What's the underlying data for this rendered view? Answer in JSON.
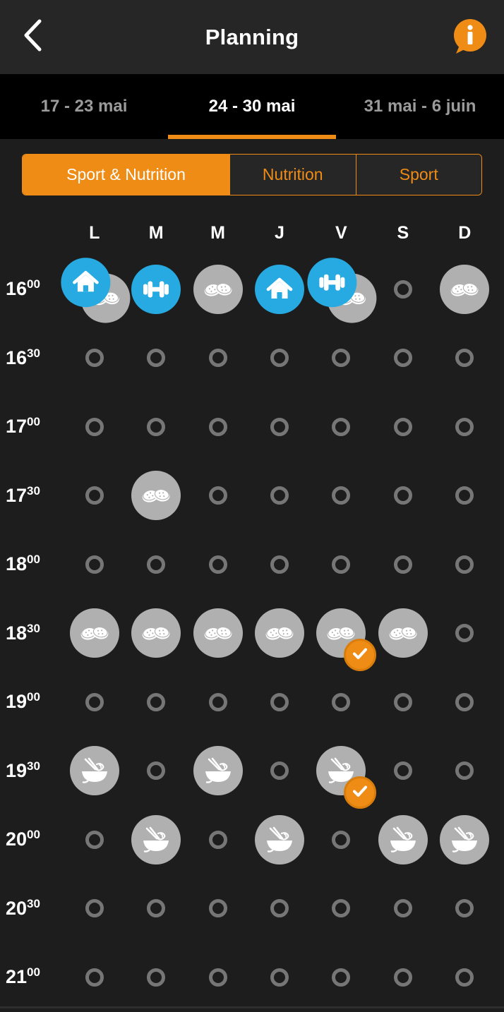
{
  "header": {
    "title": "Planning",
    "back_icon": "chevron-left-icon",
    "info_icon": "info-bubble-icon",
    "accent_color": "#ef8c16",
    "bar_color": "#262626"
  },
  "week_tabs": {
    "items": [
      {
        "label": "17 - 23 mai",
        "active": false
      },
      {
        "label": "24 - 30 mai",
        "active": true
      },
      {
        "label": "31 mai - 6 juin",
        "active": false
      }
    ]
  },
  "filter_segment": {
    "items": [
      {
        "label": "Sport & Nutrition",
        "active": true
      },
      {
        "label": "Nutrition",
        "active": false
      },
      {
        "label": "Sport",
        "active": false
      }
    ]
  },
  "calendar": {
    "days": [
      "L",
      "M",
      "M",
      "J",
      "V",
      "S",
      "D"
    ],
    "colors": {
      "sport": "#27aae1",
      "nutrition": "#b0b0b0",
      "empty_ring": "#767676",
      "check": "#ef8c16"
    },
    "rows": [
      {
        "hour": "16",
        "minutes": "00",
        "slots": [
          {
            "items": [
              {
                "icon": "home-icon",
                "type": "sport",
                "pos": "tl"
              },
              {
                "icon": "cookies-icon",
                "type": "nutrition",
                "pos": "br"
              }
            ],
            "checked": false
          },
          {
            "items": [
              {
                "icon": "dumbbell-icon",
                "type": "sport",
                "pos": "center"
              }
            ],
            "checked": false
          },
          {
            "items": [
              {
                "icon": "cookies-icon",
                "type": "nutrition",
                "pos": "center"
              }
            ],
            "checked": false
          },
          {
            "items": [
              {
                "icon": "home-icon",
                "type": "sport",
                "pos": "center"
              }
            ],
            "checked": false
          },
          {
            "items": [
              {
                "icon": "dumbbell-icon",
                "type": "sport",
                "pos": "tl"
              },
              {
                "icon": "cookies-icon",
                "type": "nutrition",
                "pos": "br"
              }
            ],
            "checked": false
          },
          {
            "items": [],
            "checked": false
          },
          {
            "items": [
              {
                "icon": "cookies-icon",
                "type": "nutrition",
                "pos": "center"
              }
            ],
            "checked": false
          }
        ]
      },
      {
        "hour": "16",
        "minutes": "30",
        "slots": [
          {
            "items": [],
            "checked": false
          },
          {
            "items": [],
            "checked": false
          },
          {
            "items": [],
            "checked": false
          },
          {
            "items": [],
            "checked": false
          },
          {
            "items": [],
            "checked": false
          },
          {
            "items": [],
            "checked": false
          },
          {
            "items": [],
            "checked": false
          }
        ]
      },
      {
        "hour": "17",
        "minutes": "00",
        "slots": [
          {
            "items": [],
            "checked": false
          },
          {
            "items": [],
            "checked": false
          },
          {
            "items": [],
            "checked": false
          },
          {
            "items": [],
            "checked": false
          },
          {
            "items": [],
            "checked": false
          },
          {
            "items": [],
            "checked": false
          },
          {
            "items": [],
            "checked": false
          }
        ]
      },
      {
        "hour": "17",
        "minutes": "30",
        "slots": [
          {
            "items": [],
            "checked": false
          },
          {
            "items": [
              {
                "icon": "cookies-icon",
                "type": "nutrition",
                "pos": "center"
              }
            ],
            "checked": false
          },
          {
            "items": [],
            "checked": false
          },
          {
            "items": [],
            "checked": false
          },
          {
            "items": [],
            "checked": false
          },
          {
            "items": [],
            "checked": false
          },
          {
            "items": [],
            "checked": false
          }
        ]
      },
      {
        "hour": "18",
        "minutes": "00",
        "slots": [
          {
            "items": [],
            "checked": false
          },
          {
            "items": [],
            "checked": false
          },
          {
            "items": [],
            "checked": false
          },
          {
            "items": [],
            "checked": false
          },
          {
            "items": [],
            "checked": false
          },
          {
            "items": [],
            "checked": false
          },
          {
            "items": [],
            "checked": false
          }
        ]
      },
      {
        "hour": "18",
        "minutes": "30",
        "slots": [
          {
            "items": [
              {
                "icon": "cookies-icon",
                "type": "nutrition",
                "pos": "center"
              }
            ],
            "checked": false
          },
          {
            "items": [
              {
                "icon": "cookies-icon",
                "type": "nutrition",
                "pos": "center"
              }
            ],
            "checked": false
          },
          {
            "items": [
              {
                "icon": "cookies-icon",
                "type": "nutrition",
                "pos": "center"
              }
            ],
            "checked": false
          },
          {
            "items": [
              {
                "icon": "cookies-icon",
                "type": "nutrition",
                "pos": "center"
              }
            ],
            "checked": false
          },
          {
            "items": [
              {
                "icon": "cookies-icon",
                "type": "nutrition",
                "pos": "center"
              }
            ],
            "checked": true
          },
          {
            "items": [
              {
                "icon": "cookies-icon",
                "type": "nutrition",
                "pos": "center"
              }
            ],
            "checked": false
          },
          {
            "items": [],
            "checked": false
          }
        ]
      },
      {
        "hour": "19",
        "minutes": "00",
        "slots": [
          {
            "items": [],
            "checked": false
          },
          {
            "items": [],
            "checked": false
          },
          {
            "items": [],
            "checked": false
          },
          {
            "items": [],
            "checked": false
          },
          {
            "items": [],
            "checked": false
          },
          {
            "items": [],
            "checked": false
          },
          {
            "items": [],
            "checked": false
          }
        ]
      },
      {
        "hour": "19",
        "minutes": "30",
        "slots": [
          {
            "items": [
              {
                "icon": "meal-bowl-icon",
                "type": "nutrition",
                "pos": "center"
              }
            ],
            "checked": false
          },
          {
            "items": [],
            "checked": false
          },
          {
            "items": [
              {
                "icon": "meal-bowl-icon",
                "type": "nutrition",
                "pos": "center"
              }
            ],
            "checked": false
          },
          {
            "items": [],
            "checked": false
          },
          {
            "items": [
              {
                "icon": "meal-bowl-icon",
                "type": "nutrition",
                "pos": "center"
              }
            ],
            "checked": true
          },
          {
            "items": [],
            "checked": false
          },
          {
            "items": [],
            "checked": false
          }
        ]
      },
      {
        "hour": "20",
        "minutes": "00",
        "slots": [
          {
            "items": [],
            "checked": false
          },
          {
            "items": [
              {
                "icon": "meal-bowl-icon",
                "type": "nutrition",
                "pos": "center"
              }
            ],
            "checked": false
          },
          {
            "items": [],
            "checked": false
          },
          {
            "items": [
              {
                "icon": "meal-bowl-icon",
                "type": "nutrition",
                "pos": "center"
              }
            ],
            "checked": false
          },
          {
            "items": [],
            "checked": false
          },
          {
            "items": [
              {
                "icon": "meal-bowl-icon",
                "type": "nutrition",
                "pos": "center"
              }
            ],
            "checked": false
          },
          {
            "items": [
              {
                "icon": "meal-bowl-icon",
                "type": "nutrition",
                "pos": "center"
              }
            ],
            "checked": false
          }
        ]
      },
      {
        "hour": "20",
        "minutes": "30",
        "slots": [
          {
            "items": [],
            "checked": false
          },
          {
            "items": [],
            "checked": false
          },
          {
            "items": [],
            "checked": false
          },
          {
            "items": [],
            "checked": false
          },
          {
            "items": [],
            "checked": false
          },
          {
            "items": [],
            "checked": false
          },
          {
            "items": [],
            "checked": false
          }
        ]
      },
      {
        "hour": "21",
        "minutes": "00",
        "slots": [
          {
            "items": [],
            "checked": false
          },
          {
            "items": [],
            "checked": false
          },
          {
            "items": [],
            "checked": false
          },
          {
            "items": [],
            "checked": false
          },
          {
            "items": [],
            "checked": false
          },
          {
            "items": [],
            "checked": false
          },
          {
            "items": [],
            "checked": false
          }
        ]
      }
    ]
  }
}
